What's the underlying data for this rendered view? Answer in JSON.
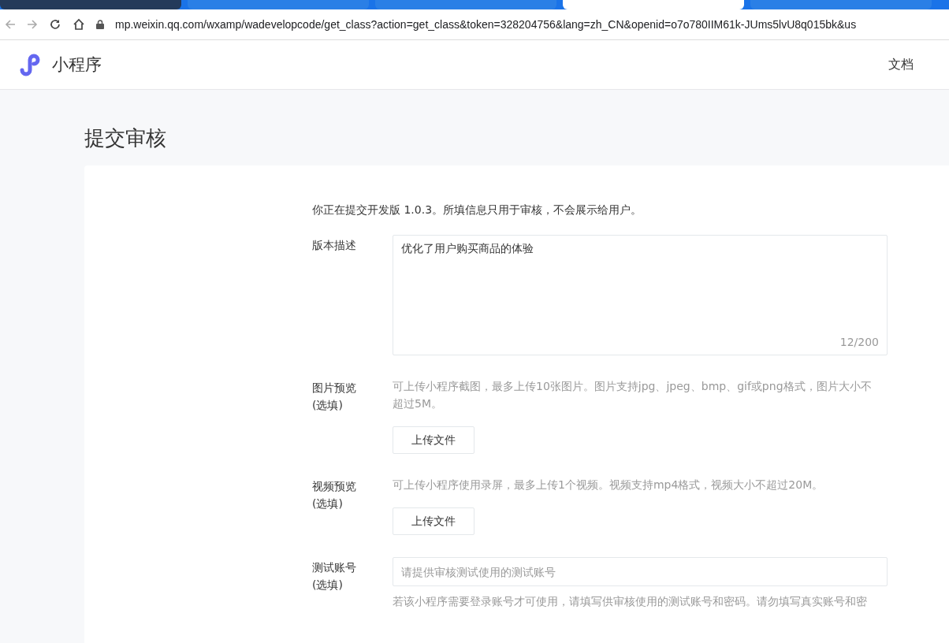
{
  "browser_tabs": [
    {
      "selected": false
    },
    {
      "selected": false
    },
    {
      "selected": false
    },
    {
      "selected": true
    },
    {
      "selected": false
    }
  ],
  "address_bar": {
    "url": "mp.weixin.qq.com/wxamp/wadevelopcode/get_class?action=get_class&token=328204756&lang=zh_CN&openid=o7o780IIM61k-JUms5lvU8q015bk&us"
  },
  "header": {
    "logo_text": "小程序",
    "nav": [
      "文档"
    ]
  },
  "page_title": "提交审核",
  "intro": "你正在提交开发版 1.0.3。所填信息只用于审核，不会展示给用户。",
  "fields": [
    {
      "kind": "textarea",
      "label": "版本描述",
      "value": "优化了用户购买商品的体验",
      "counter": "12/200"
    },
    {
      "kind": "upload",
      "label": "图片预览",
      "optional": "(选填)",
      "hint": "可上传小程序截图，最多上传10张图片。图片支持jpg、jpeg、bmp、gif或png格式，图片大小不超过5M。",
      "button": "上传文件"
    },
    {
      "kind": "upload",
      "label": "视频预览",
      "optional": "(选填)",
      "hint": "可上传小程序使用录屏，最多上传1个视频。视频支持mp4格式，视频大小不超过20M。",
      "button": "上传文件"
    },
    {
      "kind": "input",
      "label": "测试账号",
      "optional": "(选填)",
      "placeholder": "请提供审核测试使用的测试账号",
      "hint": "若该小程序需要登录账号才可使用，请填写供审核使用的测试账号和密码。请勿填写真实账号和密"
    }
  ]
}
